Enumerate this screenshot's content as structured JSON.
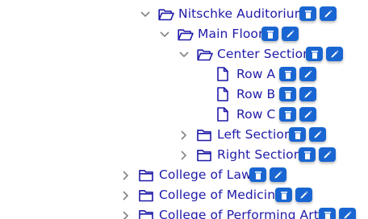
{
  "colors": {
    "label": "#1f1aa8",
    "icon": "#1f1aa8",
    "chevron": "#888888",
    "button_bg": "#1966d2",
    "button_icon": "#ffffff"
  },
  "icons": {
    "expanded": "chevron-down-icon",
    "collapsed": "chevron-right-icon",
    "folder_open": "folder-open-icon",
    "folder_closed": "folder-icon",
    "file": "file-icon",
    "delete": "trash-icon",
    "edit": "pencil-icon"
  },
  "tree": {
    "nodes": [
      {
        "label": "Nitschke Auditorium",
        "type": "folder",
        "expanded": true
      },
      {
        "label": "Main Floor",
        "type": "folder",
        "expanded": true
      },
      {
        "label": "Center Section",
        "type": "folder",
        "expanded": true
      },
      {
        "label": "Row A",
        "type": "file"
      },
      {
        "label": "Row B",
        "type": "file"
      },
      {
        "label": "Row C",
        "type": "file"
      },
      {
        "label": "Left Section",
        "type": "folder",
        "expanded": false
      },
      {
        "label": "Right Section",
        "type": "folder",
        "expanded": false
      },
      {
        "label": "College of Law",
        "type": "folder",
        "expanded": false
      },
      {
        "label": "College of Medicine",
        "type": "folder",
        "expanded": false
      },
      {
        "label": "College of Performing Arts",
        "type": "folder",
        "expanded": false
      }
    ]
  }
}
